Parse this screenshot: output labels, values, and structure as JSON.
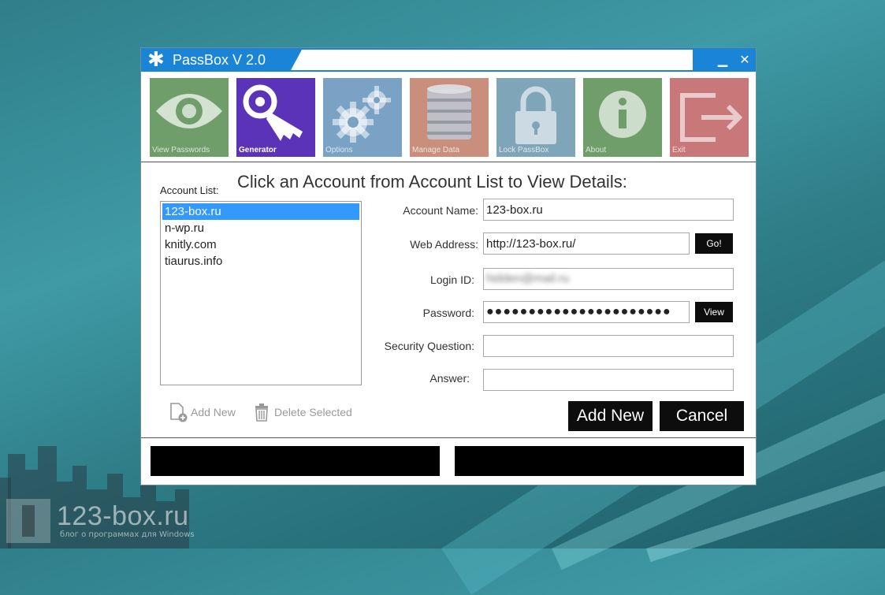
{
  "window": {
    "title": "PassBox V 2.0",
    "minimize_glyph": "▁",
    "close_glyph": "✕"
  },
  "tiles": [
    {
      "label": "View Passwords",
      "icon": "eye-icon",
      "color": "#6f9e6a"
    },
    {
      "label": "Generator",
      "icon": "key-icon",
      "color": "#5a33b8",
      "active": true
    },
    {
      "label": "Options",
      "icon": "gears-icon",
      "color": "#7aa2c4"
    },
    {
      "label": "Manage Data",
      "icon": "database-icon",
      "color": "#c98f7c"
    },
    {
      "label": "Lock PassBox",
      "icon": "lock-icon",
      "color": "#7fa5b8"
    },
    {
      "label": "About",
      "icon": "info-icon",
      "color": "#6f9e6a"
    },
    {
      "label": "Exit",
      "icon": "exit-icon",
      "color": "#c9787a"
    }
  ],
  "headline": "Click an Account from Account List to View Details:",
  "account_list": {
    "label": "Account List:",
    "items": [
      "123-box.ru",
      "n-wp.ru",
      "knitly.com",
      "tiaurus.info"
    ],
    "selected_index": 0
  },
  "details": {
    "account_name": {
      "label": "Account Name:",
      "value": "123-box.ru"
    },
    "web_address": {
      "label": "Web Address:",
      "value": "http://123-box.ru/",
      "go_label": "Go!"
    },
    "login_id": {
      "label": "Login ID:",
      "value": "hidden@mail.ru"
    },
    "password": {
      "label": "Password:",
      "value": "●●●●●●●●●●●●●●●●●●●●●●",
      "view_label": "View"
    },
    "security_question": {
      "label": "Security Question:",
      "value": ""
    },
    "answer": {
      "label": "Answer:",
      "value": ""
    }
  },
  "actions": {
    "add_new_small": "Add New",
    "delete_selected": "Delete Selected",
    "add_new_button": "Add New",
    "cancel_button": "Cancel"
  },
  "watermark": {
    "brand": "123-box.ru",
    "tagline": "блог о программах для Windows"
  },
  "colors": {
    "titlebar": "#1a84d6",
    "selection": "#3399ff",
    "button": "#0d0d0d"
  }
}
